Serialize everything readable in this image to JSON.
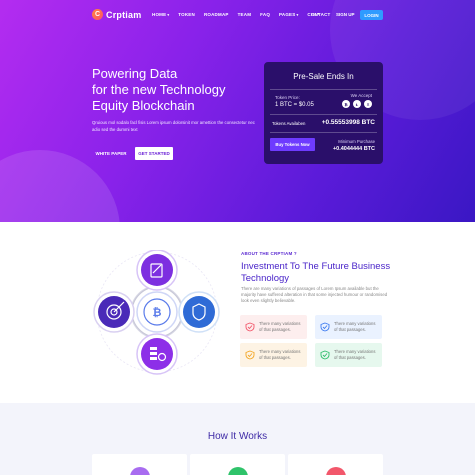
{
  "nav": {
    "logo": "Crptiam",
    "items": [
      {
        "label": "HOME",
        "caret": true
      },
      {
        "label": "TOKEN",
        "caret": false
      },
      {
        "label": "ROADMAP",
        "caret": false
      },
      {
        "label": "TEAM",
        "caret": false
      },
      {
        "label": "FAQ",
        "caret": false
      },
      {
        "label": "PAGES",
        "caret": true
      },
      {
        "label": "CONTACT",
        "caret": false
      }
    ],
    "lang": "En",
    "signup": "SIGN UP",
    "login": "LOGIN"
  },
  "hero": {
    "title_lines": [
      "Powering Data",
      "for the new Technology",
      "Equity Blockchain"
    ],
    "desc": "Qruious mol sodalo facl fisis Lorem ipsum dolorsinit mor amettion the consectetur nec adio sed the dummi text",
    "white_paper": "WHITE PAPER",
    "get_started": "GET STARTED"
  },
  "presale": {
    "title": "Pre-Sale Ends In",
    "token_price_label": "Token Price:",
    "token_price_value": "1 BTC = $0.05",
    "we_accept_label": "We Accept",
    "coins": [
      "₿",
      "Ł",
      "Ξ"
    ],
    "tokens_label": "Tokens Availaben",
    "tokens_value": "+0.55553998 BTC",
    "buy_label": "Buy Tokens Now",
    "min_label": "Minimum Purchase",
    "min_value": "+0.4044444 BTC"
  },
  "about": {
    "kicker": "ABOUT THE CRPTIAM ?",
    "title": "Investment To The Future Business Technology",
    "desc": "There are many variations of passages of Lorem Ipsum available but the majority have suffered alteration in that some injected humour or randomised look even slightly believable.",
    "features": [
      {
        "text": "There many variations of that passages.",
        "bg": "#fdeeee",
        "color": "#f2576b"
      },
      {
        "text": "There many variations of that passages.",
        "bg": "#eaf2ff",
        "color": "#3d7bf0"
      },
      {
        "text": "There many variations of that passages.",
        "bg": "#fdf3e4",
        "color": "#f3a623"
      },
      {
        "text": "There many variations of that passages.",
        "bg": "#e6f8ee",
        "color": "#2ebd6b"
      }
    ]
  },
  "how": {
    "title": "How It Works",
    "card_colors": [
      "#a86cf0",
      "#2fc36a",
      "#f2576b"
    ]
  },
  "colors": {
    "accent": "#6a1fd6",
    "login": "#2f9bff",
    "presale_bg": "#2a0f6a"
  }
}
